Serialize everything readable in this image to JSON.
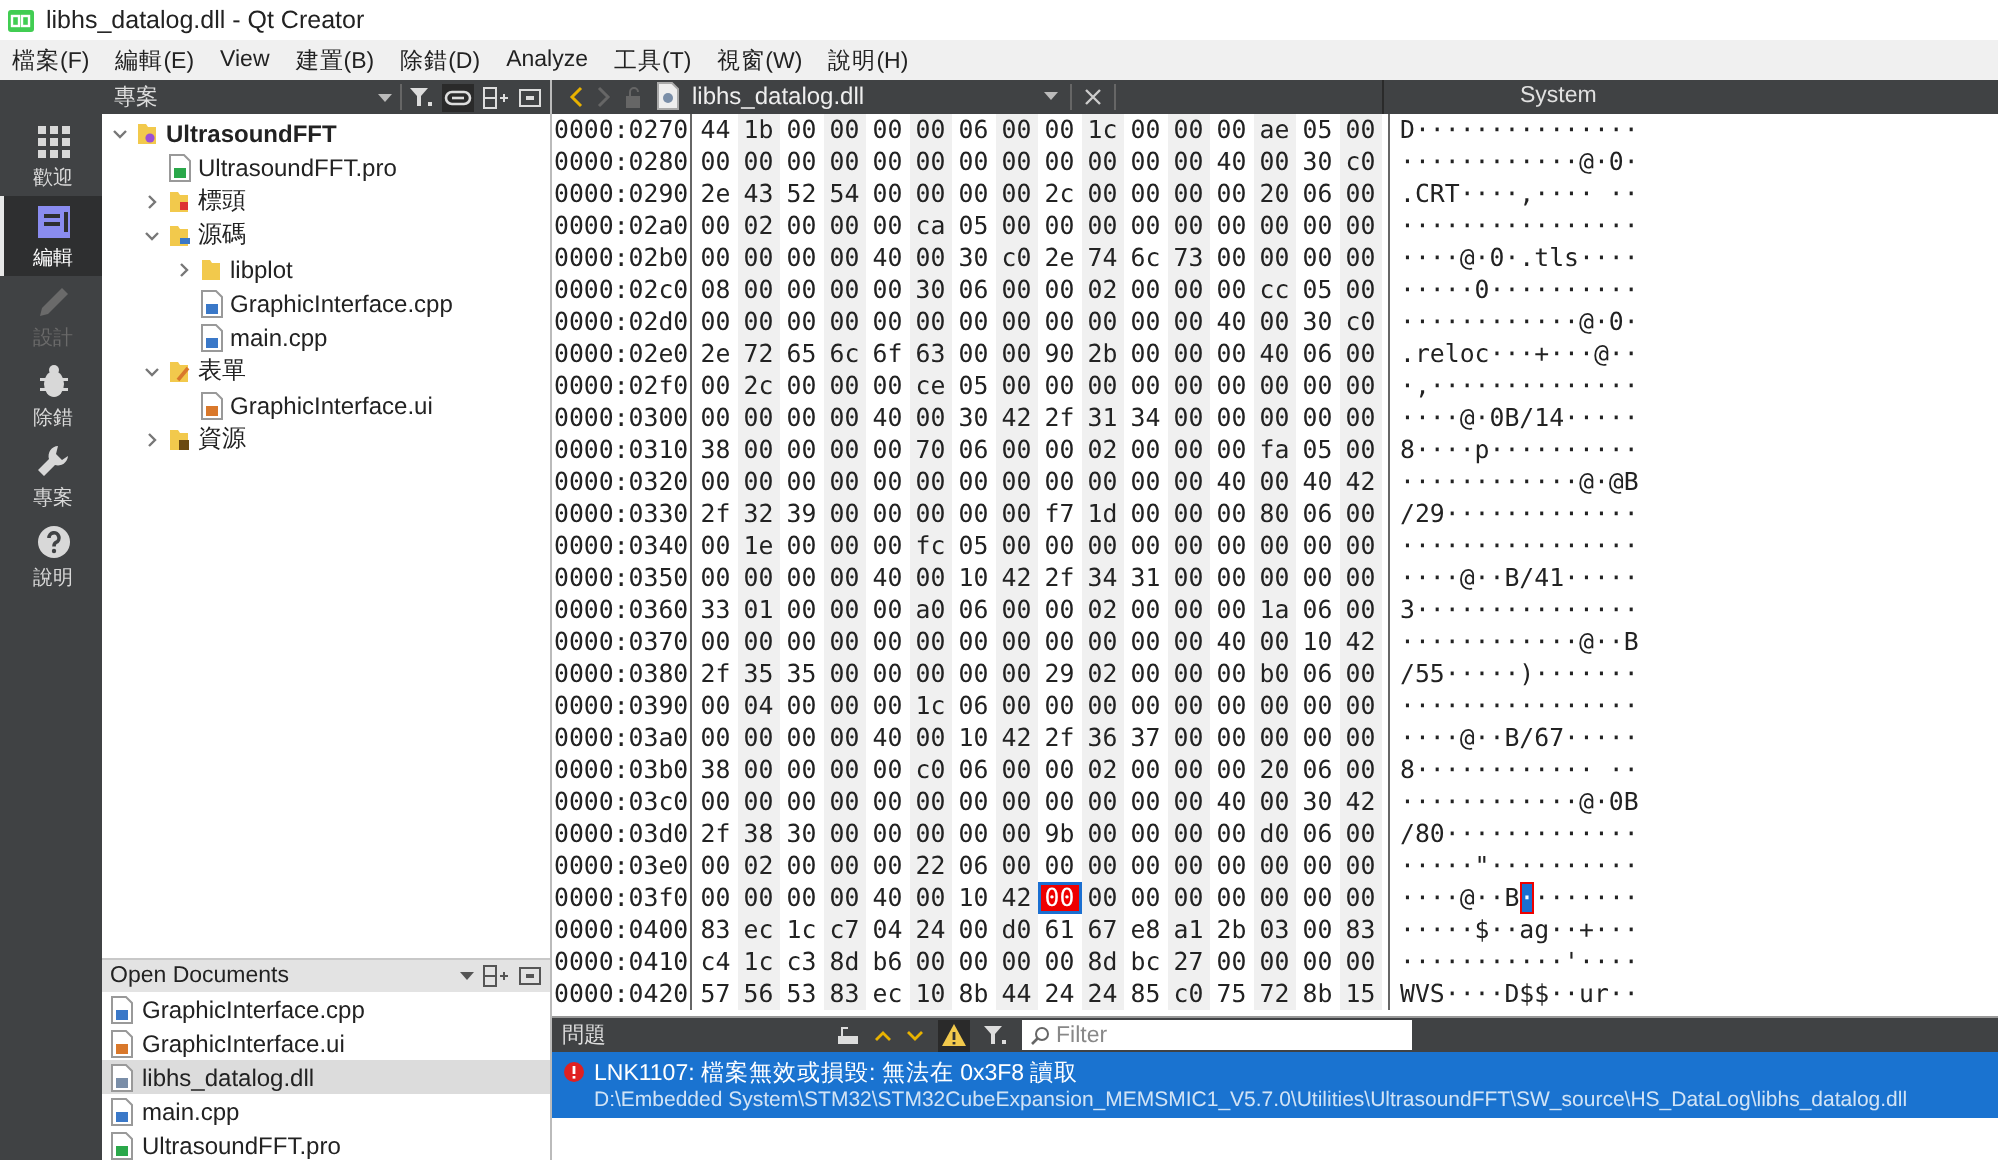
{
  "window": {
    "title": "libhs_datalog.dll - Qt Creator"
  },
  "menu": [
    "檔案(F)",
    "編輯(E)",
    "View",
    "建置(B)",
    "除錯(D)",
    "Analyze",
    "工具(T)",
    "視窗(W)",
    "說明(H)"
  ],
  "modes": [
    {
      "label": "歡迎",
      "kind": "welcome",
      "selected": false,
      "disabled": false
    },
    {
      "label": "編輯",
      "kind": "edit",
      "selected": true,
      "disabled": false
    },
    {
      "label": "設計",
      "kind": "design",
      "selected": false,
      "disabled": true
    },
    {
      "label": "除錯",
      "kind": "debug",
      "selected": false,
      "disabled": false
    },
    {
      "label": "專案",
      "kind": "projects",
      "selected": false,
      "disabled": false
    },
    {
      "label": "說明",
      "kind": "help",
      "selected": false,
      "disabled": false
    }
  ],
  "project_panel": {
    "title": "專案"
  },
  "project_tree": [
    {
      "name": "UltrasoundFFT",
      "kind": "project",
      "expanded": true,
      "children": [
        {
          "name": "UltrasoundFFT.pro",
          "kind": "pro"
        },
        {
          "name": "標頭",
          "kind": "headers",
          "expanded": false
        },
        {
          "name": "源碼",
          "kind": "sources",
          "expanded": true,
          "children": [
            {
              "name": "libplot",
              "kind": "folder",
              "expanded": false
            },
            {
              "name": "GraphicInterface.cpp",
              "kind": "cpp"
            },
            {
              "name": "main.cpp",
              "kind": "cpp"
            }
          ]
        },
        {
          "name": "表單",
          "kind": "forms",
          "expanded": true,
          "children": [
            {
              "name": "GraphicInterface.ui",
              "kind": "ui"
            }
          ]
        },
        {
          "name": "資源",
          "kind": "resources",
          "expanded": false
        }
      ]
    }
  ],
  "open_documents": {
    "title": "Open Documents",
    "items": [
      {
        "name": "GraphicInterface.cpp",
        "kind": "cpp",
        "selected": false
      },
      {
        "name": "GraphicInterface.ui",
        "kind": "ui",
        "selected": false
      },
      {
        "name": "libhs_datalog.dll",
        "kind": "binary",
        "selected": true
      },
      {
        "name": "main.cpp",
        "kind": "cpp",
        "selected": false
      },
      {
        "name": "UltrasoundFFT.pro",
        "kind": "pro",
        "selected": false
      }
    ]
  },
  "editor": {
    "navigation": [
      {
        "kind": "back",
        "disabled": false
      },
      {
        "kind": "forward",
        "disabled": true
      }
    ],
    "file": "libhs_datalog.dll",
    "encoding": "System"
  },
  "hex_rows": [
    {
      "address": "0000:0270",
      "bytes": [
        "44",
        "1b",
        "00",
        "00",
        "00",
        "00",
        "06",
        "00",
        "00",
        "1c",
        "00",
        "00",
        "00",
        "ae",
        "05",
        "00"
      ],
      "ascii": "D···············"
    },
    {
      "address": "0000:0280",
      "bytes": [
        "00",
        "00",
        "00",
        "00",
        "00",
        "00",
        "00",
        "00",
        "00",
        "00",
        "00",
        "00",
        "40",
        "00",
        "30",
        "c0"
      ],
      "ascii": "············@·0·"
    },
    {
      "address": "0000:0290",
      "bytes": [
        "2e",
        "43",
        "52",
        "54",
        "00",
        "00",
        "00",
        "00",
        "2c",
        "00",
        "00",
        "00",
        "00",
        "20",
        "06",
        "00"
      ],
      "ascii": ".CRT····,···· ··"
    },
    {
      "address": "0000:02a0",
      "bytes": [
        "00",
        "02",
        "00",
        "00",
        "00",
        "ca",
        "05",
        "00",
        "00",
        "00",
        "00",
        "00",
        "00",
        "00",
        "00",
        "00"
      ],
      "ascii": "················"
    },
    {
      "address": "0000:02b0",
      "bytes": [
        "00",
        "00",
        "00",
        "00",
        "40",
        "00",
        "30",
        "c0",
        "2e",
        "74",
        "6c",
        "73",
        "00",
        "00",
        "00",
        "00"
      ],
      "ascii": "····@·0·.tls····"
    },
    {
      "address": "0000:02c0",
      "bytes": [
        "08",
        "00",
        "00",
        "00",
        "00",
        "30",
        "06",
        "00",
        "00",
        "02",
        "00",
        "00",
        "00",
        "cc",
        "05",
        "00"
      ],
      "ascii": "·····0··········"
    },
    {
      "address": "0000:02d0",
      "bytes": [
        "00",
        "00",
        "00",
        "00",
        "00",
        "00",
        "00",
        "00",
        "00",
        "00",
        "00",
        "00",
        "40",
        "00",
        "30",
        "c0"
      ],
      "ascii": "············@·0·"
    },
    {
      "address": "0000:02e0",
      "bytes": [
        "2e",
        "72",
        "65",
        "6c",
        "6f",
        "63",
        "00",
        "00",
        "90",
        "2b",
        "00",
        "00",
        "00",
        "40",
        "06",
        "00"
      ],
      "ascii": ".reloc···+···@··"
    },
    {
      "address": "0000:02f0",
      "bytes": [
        "00",
        "2c",
        "00",
        "00",
        "00",
        "ce",
        "05",
        "00",
        "00",
        "00",
        "00",
        "00",
        "00",
        "00",
        "00",
        "00"
      ],
      "ascii": "·,··············"
    },
    {
      "address": "0000:0300",
      "bytes": [
        "00",
        "00",
        "00",
        "00",
        "40",
        "00",
        "30",
        "42",
        "2f",
        "31",
        "34",
        "00",
        "00",
        "00",
        "00",
        "00"
      ],
      "ascii": "····@·0B/14·····"
    },
    {
      "address": "0000:0310",
      "bytes": [
        "38",
        "00",
        "00",
        "00",
        "00",
        "70",
        "06",
        "00",
        "00",
        "02",
        "00",
        "00",
        "00",
        "fa",
        "05",
        "00"
      ],
      "ascii": "8····p··········"
    },
    {
      "address": "0000:0320",
      "bytes": [
        "00",
        "00",
        "00",
        "00",
        "00",
        "00",
        "00",
        "00",
        "00",
        "00",
        "00",
        "00",
        "40",
        "00",
        "40",
        "42"
      ],
      "ascii": "············@·@B"
    },
    {
      "address": "0000:0330",
      "bytes": [
        "2f",
        "32",
        "39",
        "00",
        "00",
        "00",
        "00",
        "00",
        "f7",
        "1d",
        "00",
        "00",
        "00",
        "80",
        "06",
        "00"
      ],
      "ascii": "/29·············"
    },
    {
      "address": "0000:0340",
      "bytes": [
        "00",
        "1e",
        "00",
        "00",
        "00",
        "fc",
        "05",
        "00",
        "00",
        "00",
        "00",
        "00",
        "00",
        "00",
        "00",
        "00"
      ],
      "ascii": "················"
    },
    {
      "address": "0000:0350",
      "bytes": [
        "00",
        "00",
        "00",
        "00",
        "40",
        "00",
        "10",
        "42",
        "2f",
        "34",
        "31",
        "00",
        "00",
        "00",
        "00",
        "00"
      ],
      "ascii": "····@··B/41·····"
    },
    {
      "address": "0000:0360",
      "bytes": [
        "33",
        "01",
        "00",
        "00",
        "00",
        "a0",
        "06",
        "00",
        "00",
        "02",
        "00",
        "00",
        "00",
        "1a",
        "06",
        "00"
      ],
      "ascii": "3···············"
    },
    {
      "address": "0000:0370",
      "bytes": [
        "00",
        "00",
        "00",
        "00",
        "00",
        "00",
        "00",
        "00",
        "00",
        "00",
        "00",
        "00",
        "40",
        "00",
        "10",
        "42"
      ],
      "ascii": "············@··B"
    },
    {
      "address": "0000:0380",
      "bytes": [
        "2f",
        "35",
        "35",
        "00",
        "00",
        "00",
        "00",
        "00",
        "29",
        "02",
        "00",
        "00",
        "00",
        "b0",
        "06",
        "00"
      ],
      "ascii": "/55·····)·······"
    },
    {
      "address": "0000:0390",
      "bytes": [
        "00",
        "04",
        "00",
        "00",
        "00",
        "1c",
        "06",
        "00",
        "00",
        "00",
        "00",
        "00",
        "00",
        "00",
        "00",
        "00"
      ],
      "ascii": "················"
    },
    {
      "address": "0000:03a0",
      "bytes": [
        "00",
        "00",
        "00",
        "00",
        "40",
        "00",
        "10",
        "42",
        "2f",
        "36",
        "37",
        "00",
        "00",
        "00",
        "00",
        "00"
      ],
      "ascii": "····@··B/67·····"
    },
    {
      "address": "0000:03b0",
      "bytes": [
        "38",
        "00",
        "00",
        "00",
        "00",
        "c0",
        "06",
        "00",
        "00",
        "02",
        "00",
        "00",
        "00",
        "20",
        "06",
        "00"
      ],
      "ascii": "8············ ··"
    },
    {
      "address": "0000:03c0",
      "bytes": [
        "00",
        "00",
        "00",
        "00",
        "00",
        "00",
        "00",
        "00",
        "00",
        "00",
        "00",
        "00",
        "40",
        "00",
        "30",
        "42"
      ],
      "ascii": "············@·0B"
    },
    {
      "address": "0000:03d0",
      "bytes": [
        "2f",
        "38",
        "30",
        "00",
        "00",
        "00",
        "00",
        "00",
        "9b",
        "00",
        "00",
        "00",
        "00",
        "d0",
        "06",
        "00"
      ],
      "ascii": "/80·············"
    },
    {
      "address": "0000:03e0",
      "bytes": [
        "00",
        "02",
        "00",
        "00",
        "00",
        "22",
        "06",
        "00",
        "00",
        "00",
        "00",
        "00",
        "00",
        "00",
        "00",
        "00"
      ],
      "ascii": "·····\"··········"
    },
    {
      "address": "0000:03f0",
      "bytes": [
        "00",
        "00",
        "00",
        "00",
        "40",
        "00",
        "10",
        "42"
      ],
      "cursor": {
        "byte": "00",
        "char": "·"
      },
      "bytes_after": [
        "00",
        "00",
        "00",
        "00",
        "00",
        "00",
        "00"
      ],
      "ascii": "····@··B",
      "ascii_after": "·······"
    },
    {
      "address": "0000:0400",
      "bytes": [
        "83",
        "ec",
        "1c",
        "c7",
        "04",
        "24",
        "00",
        "d0",
        "61",
        "67",
        "e8",
        "a1",
        "2b",
        "03",
        "00",
        "83"
      ],
      "ascii": "·····$··ag··+···"
    },
    {
      "address": "0000:0410",
      "bytes": [
        "c4",
        "1c",
        "c3",
        "8d",
        "b6",
        "00",
        "00",
        "00",
        "00",
        "8d",
        "bc",
        "27",
        "00",
        "00",
        "00",
        "00"
      ],
      "ascii": "···········'····"
    },
    {
      "address": "0000:0420",
      "bytes": [
        "57",
        "56",
        "53",
        "83",
        "ec",
        "10",
        "8b",
        "44",
        "24",
        "24",
        "85",
        "c0",
        "75",
        "72",
        "8b",
        "15"
      ],
      "ascii": "WVS····D$$··ur··"
    }
  ],
  "issues_panel": {
    "title": "問題",
    "filter": {
      "placeholder": "Filter"
    },
    "warnings_filter_on": true,
    "issues": [
      {
        "kind": "error",
        "selected": true,
        "message": "LNK1107: 檔案無效或損毀: 無法在 0x3F8 讀取",
        "path": "D:\\Embedded System\\STM32\\STM32CubeExpansion_MEMSMIC1_V5.7.0\\Utilities\\UltrasoundFFT\\SW_source\\HS_DataLog\\libhs_datalog.dll"
      }
    ]
  }
}
